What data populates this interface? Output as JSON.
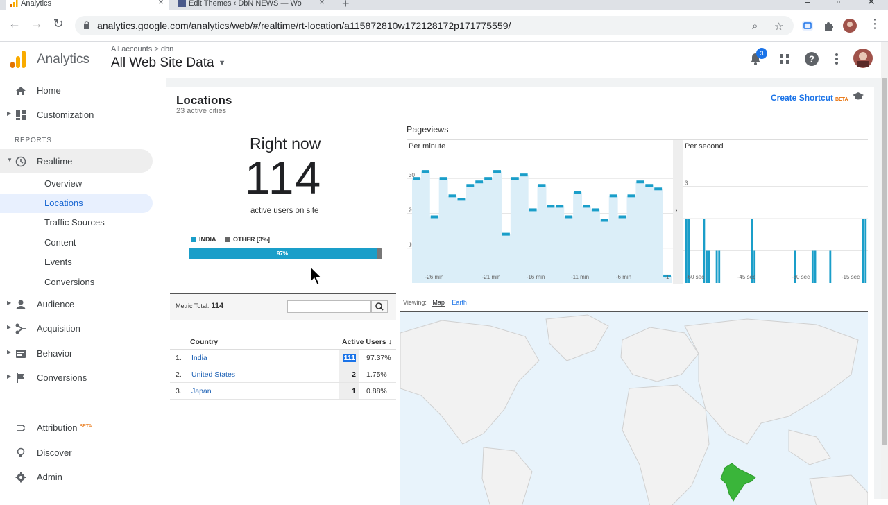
{
  "browser": {
    "tabs": [
      {
        "title": "Analytics"
      },
      {
        "title": "Edit Themes ‹ DbN NEWS — Wo"
      }
    ],
    "url": "analytics.google.com/analytics/web/#/realtime/rt-location/a115872810w172128172p171775559/"
  },
  "header": {
    "product": "Analytics",
    "breadcrumb": "All accounts  >  dbn",
    "view": "All Web Site Data",
    "notification_count": "3"
  },
  "sidebar": {
    "top_items": [
      {
        "label": "Home",
        "icon": "home-icon"
      },
      {
        "label": "Customization",
        "icon": "dashboard-icon"
      }
    ],
    "reports_heading": "REPORTS",
    "realtime": {
      "label": "Realtime",
      "icon": "clock-icon"
    },
    "realtime_sub": [
      "Overview",
      "Locations",
      "Traffic Sources",
      "Content",
      "Events",
      "Conversions"
    ],
    "report_items": [
      {
        "label": "Audience",
        "icon": "person-icon"
      },
      {
        "label": "Acquisition",
        "icon": "acquisition-icon"
      },
      {
        "label": "Behavior",
        "icon": "behavior-icon"
      },
      {
        "label": "Conversions",
        "icon": "flag-icon"
      }
    ],
    "bottom_items": [
      {
        "label": "Attribution",
        "icon": "attribution-icon",
        "tag": "BETA"
      },
      {
        "label": "Discover",
        "icon": "lightbulb-icon"
      },
      {
        "label": "Admin",
        "icon": "gear-icon"
      }
    ]
  },
  "report": {
    "title": "Locations",
    "subtitle": "23 active cities",
    "shortcut": "Create Shortcut",
    "shortcut_tag": "BETA",
    "right_now_label": "Right now",
    "active_users": "114",
    "active_users_label": "active users on site",
    "legend_india": "INDIA",
    "legend_other": "OTHER [3%]",
    "india_share": 0.97,
    "bar_label": "97%",
    "metric_total_label": "Metric Total:",
    "metric_total_value": "114",
    "col_country": "Country",
    "col_users": "Active Users",
    "rows": [
      {
        "idx": "1.",
        "country": "India",
        "users": "111",
        "pct": "97.37%"
      },
      {
        "idx": "2.",
        "country": "United States",
        "users": "2",
        "pct": "1.75%"
      },
      {
        "idx": "3.",
        "country": "Japan",
        "users": "1",
        "pct": "0.88%"
      }
    ],
    "pageviews_title": "Pageviews",
    "per_minute": "Per minute",
    "per_second": "Per second",
    "viewing_label": "Viewing:",
    "view_map": "Map",
    "view_earth": "Earth"
  },
  "chart_data": [
    {
      "type": "bar",
      "title": "Per minute",
      "x_ticks": [
        "-26 min",
        "-21 min",
        "-16 min",
        "-11 min",
        "-6 min",
        "-1"
      ],
      "y_ticks": [
        10,
        20,
        30
      ],
      "ylim": [
        0,
        37
      ],
      "values": [
        30,
        32,
        19,
        30,
        25,
        24,
        28,
        29,
        30,
        32,
        14,
        30,
        31,
        21,
        28,
        22,
        22,
        19,
        26,
        22,
        21,
        18,
        25,
        19,
        25,
        29,
        28,
        27,
        2
      ]
    },
    {
      "type": "bar",
      "title": "Per second",
      "x_ticks": [
        "-60 sec",
        "-45 sec",
        "-30 sec",
        "-15 sec"
      ],
      "y_ticks": [
        3
      ],
      "ylim": [
        0,
        4
      ],
      "values": [
        2,
        2,
        0,
        0,
        0,
        0,
        0,
        2,
        1,
        1,
        0,
        0,
        1,
        1,
        0,
        0,
        0,
        0,
        0,
        0,
        0,
        0,
        0,
        0,
        0,
        0,
        2,
        1,
        0,
        0,
        0,
        0,
        0,
        0,
        0,
        0,
        0,
        0,
        0,
        0,
        0,
        0,
        0,
        1,
        0,
        0,
        0,
        0,
        0,
        0,
        1,
        1,
        0,
        0,
        0,
        0,
        0,
        1,
        0,
        0,
        0,
        0,
        0,
        0,
        0,
        0,
        0,
        0,
        0,
        0,
        2,
        2
      ]
    }
  ],
  "colors": {
    "accent": "#1a9ec9",
    "other": "#777777",
    "map_highlight": "#3ab53a",
    "link": "#1a73e8"
  }
}
